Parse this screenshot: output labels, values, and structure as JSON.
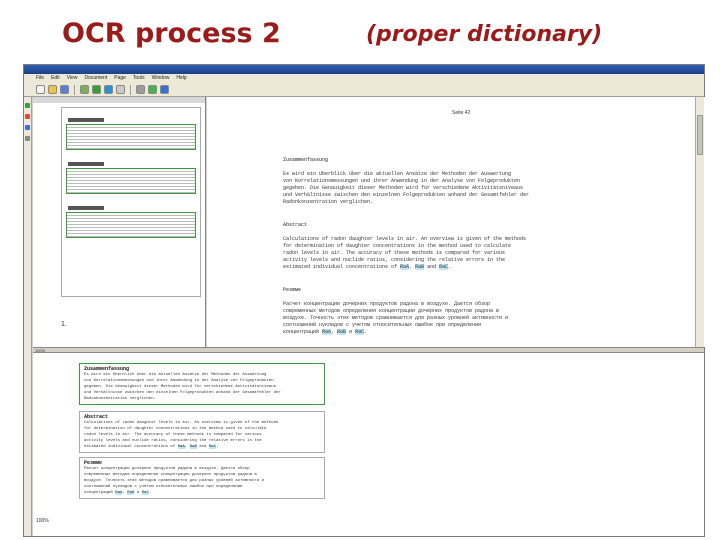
{
  "slide": {
    "title": "OCR process 2",
    "subtitle": "(proper dictionary)"
  },
  "app": {
    "titlebar_text": "",
    "menu": [
      "File",
      "Edit",
      "View",
      "Document",
      "Page",
      "Tools",
      "Window",
      "Help"
    ],
    "toolbar_icons": [
      "new-icon",
      "open-icon",
      "save-icon",
      "scan-icon",
      "read-icon",
      "check-icon",
      "zoom-icon",
      "settings-icon",
      "green-tool-icon",
      "blue-tool-icon"
    ],
    "colors": {
      "titlebar": "#1c3f8a",
      "block_outline": "#3c9b3c",
      "highlight": "#bfe6f5"
    },
    "thumbnail_footer": "1.",
    "page_number": "Seite 42",
    "pane_zoom": "100%"
  },
  "document": {
    "sections": [
      {
        "heading": "Zusammenfassung",
        "lines": [
          "Es wird ein Überblick über die aktuellen Ansätze der Methoden der Auswertung",
          "von Korrelationsmessungen und ihrer Anwendung in der Analyse von Folgeprodukten",
          "gegeben. Die Genauigkeit dieser Methoden wird für verschiedene Aktivitätsniveaus",
          "und Verhältnisse zwischen den einzelnen Folgeprodukten anhand der Gesamtfehler der",
          "Radonkonzentration verglichen."
        ]
      },
      {
        "heading": "Abstract",
        "lines": [
          "Calculations of radon daughter levels in air. An overview is given of the methods",
          "for determination of daughter concentrations in the method used to calculate",
          "radon levels in air. The accuracy of these methods is compared for various",
          "activity levels and nuclide ratios, considering the relative errors in the",
          "estimated individual concentrations of RaA, RaB and RaC."
        ]
      },
      {
        "heading": "Резюме",
        "lines": [
          "Расчет концентрации дочерних продуктов радона в воздухе. Дается обзор",
          "современных методов определения концентрации дочерних продуктов радона в",
          "воздухе. Точность этих методов сравнивается для разных уровней активности и",
          "соотношений нуклидов с учетом относительных ошибок при определении",
          "концентраций RaA, RaB и RaC."
        ]
      }
    ]
  }
}
